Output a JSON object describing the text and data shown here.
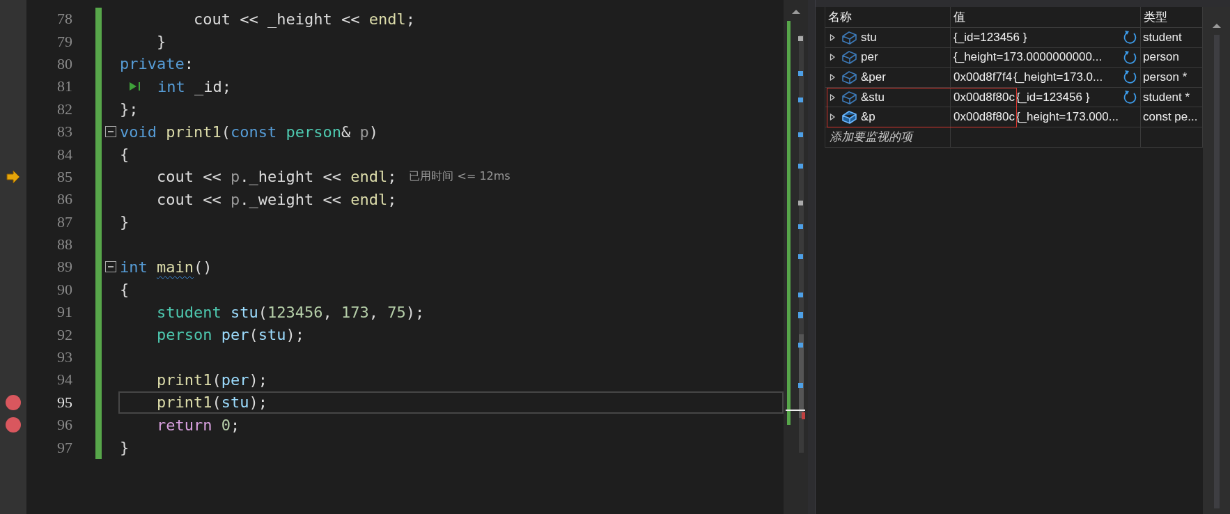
{
  "editor": {
    "lines": [
      {
        "number": "78",
        "current": false,
        "breakpoint": false,
        "run_to_click": false,
        "selected": false,
        "changed": true,
        "tokens": [
          {
            "text": "        cout",
            "kind": "plain"
          },
          {
            "text": " << ",
            "kind": "plain"
          },
          {
            "text": "_height",
            "kind": "plain"
          },
          {
            "text": " << ",
            "kind": "plain"
          },
          {
            "text": "endl",
            "kind": "fn"
          },
          {
            "text": ";",
            "kind": "plain"
          }
        ]
      },
      {
        "number": "79",
        "current": false,
        "breakpoint": false,
        "run_to_click": false,
        "selected": false,
        "changed": true,
        "tokens": [
          {
            "text": "    }",
            "kind": "plain"
          }
        ]
      },
      {
        "number": "80",
        "current": false,
        "breakpoint": false,
        "run_to_click": false,
        "selected": false,
        "changed": true,
        "tokens": [
          {
            "text": "private",
            "kind": "kw"
          },
          {
            "text": ":",
            "kind": "plain"
          }
        ]
      },
      {
        "number": "81",
        "current": false,
        "breakpoint": false,
        "run_to_click": true,
        "selected": false,
        "changed": true,
        "tokens": [
          {
            "text": "int",
            "kind": "kw"
          },
          {
            "text": " _id;",
            "kind": "plain"
          }
        ]
      },
      {
        "number": "82",
        "current": false,
        "breakpoint": false,
        "run_to_click": false,
        "selected": false,
        "changed": true,
        "tokens": [
          {
            "text": "};",
            "kind": "plain"
          }
        ]
      },
      {
        "number": "83",
        "current": false,
        "breakpoint": false,
        "run_to_click": false,
        "selected": false,
        "changed": true,
        "fold": {
          "expanded": true
        },
        "tokens": [
          {
            "text": "void",
            "kind": "kw"
          },
          {
            "text": " print1",
            "kind": "fn"
          },
          {
            "text": "(",
            "kind": "plain"
          },
          {
            "text": "const",
            "kind": "kw"
          },
          {
            "text": " person",
            "kind": "type"
          },
          {
            "text": "& ",
            "kind": "plain"
          },
          {
            "text": "p",
            "kind": "param"
          },
          {
            "text": ")",
            "kind": "plain"
          }
        ]
      },
      {
        "number": "84",
        "current": false,
        "breakpoint": false,
        "run_to_click": false,
        "selected": false,
        "changed": true,
        "tokens": [
          {
            "text": "{",
            "kind": "plain"
          }
        ]
      },
      {
        "number": "85",
        "current": true,
        "breakpoint": false,
        "run_to_click": false,
        "selected": false,
        "changed": true,
        "hint": "已用时间 <= 12ms",
        "tokens": [
          {
            "text": "    cout",
            "kind": "plain"
          },
          {
            "text": " << ",
            "kind": "plain"
          },
          {
            "text": "p",
            "kind": "param"
          },
          {
            "text": ".",
            "kind": "plain"
          },
          {
            "text": "_height",
            "kind": "plain"
          },
          {
            "text": " << ",
            "kind": "plain"
          },
          {
            "text": "endl",
            "kind": "fn"
          },
          {
            "text": ";",
            "kind": "plain"
          }
        ]
      },
      {
        "number": "86",
        "current": false,
        "breakpoint": false,
        "run_to_click": false,
        "selected": false,
        "changed": true,
        "tokens": [
          {
            "text": "    cout",
            "kind": "plain"
          },
          {
            "text": " << ",
            "kind": "plain"
          },
          {
            "text": "p",
            "kind": "param"
          },
          {
            "text": ".",
            "kind": "plain"
          },
          {
            "text": "_weight",
            "kind": "plain"
          },
          {
            "text": " << ",
            "kind": "plain"
          },
          {
            "text": "endl",
            "kind": "fn"
          },
          {
            "text": ";",
            "kind": "plain"
          }
        ]
      },
      {
        "number": "87",
        "current": false,
        "breakpoint": false,
        "run_to_click": false,
        "selected": false,
        "changed": true,
        "tokens": [
          {
            "text": "}",
            "kind": "plain"
          }
        ]
      },
      {
        "number": "88",
        "current": false,
        "breakpoint": false,
        "run_to_click": false,
        "selected": false,
        "changed": true
      },
      {
        "number": "89",
        "current": false,
        "breakpoint": false,
        "run_to_click": false,
        "selected": false,
        "changed": true,
        "fold": {
          "expanded": true
        },
        "tokens": [
          {
            "text": "int ",
            "kind": "kw"
          },
          {
            "text": "main",
            "kind": "fn",
            "squiggle": true
          },
          {
            "text": "()",
            "kind": "plain"
          }
        ]
      },
      {
        "number": "90",
        "current": false,
        "breakpoint": false,
        "run_to_click": false,
        "selected": false,
        "changed": true,
        "tokens": [
          {
            "text": "{",
            "kind": "plain"
          }
        ]
      },
      {
        "number": "91",
        "current": false,
        "breakpoint": false,
        "run_to_click": false,
        "selected": false,
        "changed": true,
        "tokens": [
          {
            "text": "    student",
            "kind": "type"
          },
          {
            "text": " stu",
            "kind": "var"
          },
          {
            "text": "(",
            "kind": "plain"
          },
          {
            "text": "123456",
            "kind": "num"
          },
          {
            "text": ", ",
            "kind": "plain"
          },
          {
            "text": "173",
            "kind": "num"
          },
          {
            "text": ", ",
            "kind": "plain"
          },
          {
            "text": "75",
            "kind": "num"
          },
          {
            "text": ");",
            "kind": "plain"
          }
        ]
      },
      {
        "number": "92",
        "current": false,
        "breakpoint": false,
        "run_to_click": false,
        "selected": false,
        "changed": true,
        "tokens": [
          {
            "text": "    person",
            "kind": "type"
          },
          {
            "text": " per",
            "kind": "var"
          },
          {
            "text": "(",
            "kind": "plain"
          },
          {
            "text": "stu",
            "kind": "var"
          },
          {
            "text": ");",
            "kind": "plain"
          }
        ]
      },
      {
        "number": "93",
        "current": false,
        "breakpoint": false,
        "run_to_click": false,
        "selected": false,
        "changed": true
      },
      {
        "number": "94",
        "current": false,
        "breakpoint": false,
        "run_to_click": false,
        "selected": false,
        "changed": true,
        "tokens": [
          {
            "text": "    print1",
            "kind": "fn"
          },
          {
            "text": "(",
            "kind": "plain"
          },
          {
            "text": "per",
            "kind": "var"
          },
          {
            "text": ");",
            "kind": "plain"
          }
        ]
      },
      {
        "number": "95",
        "current": false,
        "breakpoint": true,
        "run_to_click": false,
        "selected": true,
        "changed": true,
        "tokens": [
          {
            "text": "    print1",
            "kind": "fn"
          },
          {
            "text": "(",
            "kind": "plain"
          },
          {
            "text": "stu",
            "kind": "var"
          },
          {
            "text": ");",
            "kind": "plain"
          }
        ]
      },
      {
        "number": "96",
        "current": false,
        "breakpoint": true,
        "run_to_click": false,
        "selected": false,
        "changed": true,
        "tokens": [
          {
            "text": "    return",
            "kind": "ctrl"
          },
          {
            "text": " 0",
            "kind": "num"
          },
          {
            "text": ";",
            "kind": "plain"
          }
        ]
      },
      {
        "number": "97",
        "current": false,
        "breakpoint": false,
        "run_to_click": false,
        "selected": false,
        "changed": true,
        "tokens": [
          {
            "text": "}",
            "kind": "plain"
          }
        ]
      }
    ]
  },
  "watch": {
    "columns": [
      "名称",
      "值",
      "类型"
    ],
    "rows": [
      {
        "name": "stu",
        "value": "{_id=123456 }",
        "type": "student",
        "refresh": true,
        "boxed": false,
        "selected": false
      },
      {
        "name": "per",
        "value": "{_height=173.0000000000...",
        "type": "person",
        "refresh": true,
        "boxed": false,
        "selected": false
      },
      {
        "name": "&per",
        "address": "0x00d8f7f4",
        "value": "{_height=173.0...",
        "type": "person *",
        "refresh": true,
        "boxed": false,
        "selected": false
      },
      {
        "name": "&stu",
        "address": "0x00d8f80c",
        "value": "{_id=123456 }",
        "type": "student *",
        "refresh": true,
        "boxed": true,
        "selected": false
      },
      {
        "name": "&p",
        "address": "0x00d8f80c",
        "value": "{_height=173.000...",
        "type": "const pe...",
        "refresh": false,
        "boxed": true,
        "selected": true
      }
    ],
    "add_placeholder": "添加要监视的项"
  }
}
